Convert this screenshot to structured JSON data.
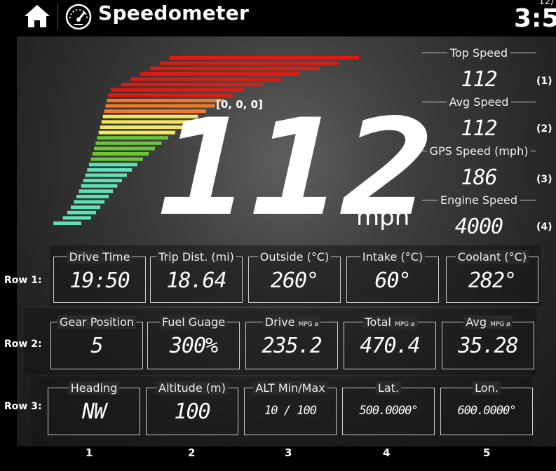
{
  "header": {
    "title": "Speedometer",
    "date": "12/",
    "time": "3:5"
  },
  "speed": {
    "rgb_label": "[0, 0, 0]",
    "value": "112",
    "unit": "mph"
  },
  "stats": [
    {
      "label": "Top Speed",
      "value": "112",
      "num": "(1)"
    },
    {
      "label": "Avg Speed",
      "value": "112",
      "num": "(2)"
    },
    {
      "label": "GPS Speed (mph)",
      "value": "186",
      "num": "(3)"
    },
    {
      "label": "Engine Speed",
      "value": "4000",
      "num": "(4)"
    }
  ],
  "rows": [
    {
      "label": "Row 1:",
      "cells": [
        {
          "label": "Drive Time",
          "sub": "",
          "value": "19:50"
        },
        {
          "label": "Trip Dist. (mi)",
          "sub": "",
          "value": "18.64"
        },
        {
          "label": "Outside (°C)",
          "sub": "",
          "value": "260°"
        },
        {
          "label": "Intake (°C)",
          "sub": "",
          "value": "60°"
        },
        {
          "label": "Coolant (°C)",
          "sub": "",
          "value": "282°"
        }
      ]
    },
    {
      "label": "Row 2:",
      "cells": [
        {
          "label": "Gear Position",
          "sub": "",
          "value": "5"
        },
        {
          "label": "Fuel Guage",
          "sub": "",
          "value": "300%"
        },
        {
          "label": "Drive",
          "sub": "MPG ø",
          "value": "235.2"
        },
        {
          "label": "Total",
          "sub": "MPG ø",
          "value": "470.4"
        },
        {
          "label": "Avg",
          "sub": "MPG ø",
          "value": "35.28"
        }
      ]
    },
    {
      "label": "Row 3:",
      "cells": [
        {
          "label": "Heading",
          "sub": "",
          "value": "NW"
        },
        {
          "label": "Altitude (m)",
          "sub": "",
          "value": "100"
        },
        {
          "label": "ALT Min/Max",
          "sub": "",
          "value": "10 / 100"
        },
        {
          "label": "Lat.",
          "sub": "",
          "value": "500.0000°"
        },
        {
          "label": "Lon.",
          "sub": "",
          "value": "600.0000°"
        }
      ]
    }
  ],
  "column_numbers": [
    "1",
    "2",
    "3",
    "4",
    "5"
  ],
  "colors": {
    "red": "#e01a10",
    "orange": "#f07a2a",
    "yellow": "#f4e85a",
    "green": "#6cc63a",
    "teal": "#5ee0b8"
  }
}
